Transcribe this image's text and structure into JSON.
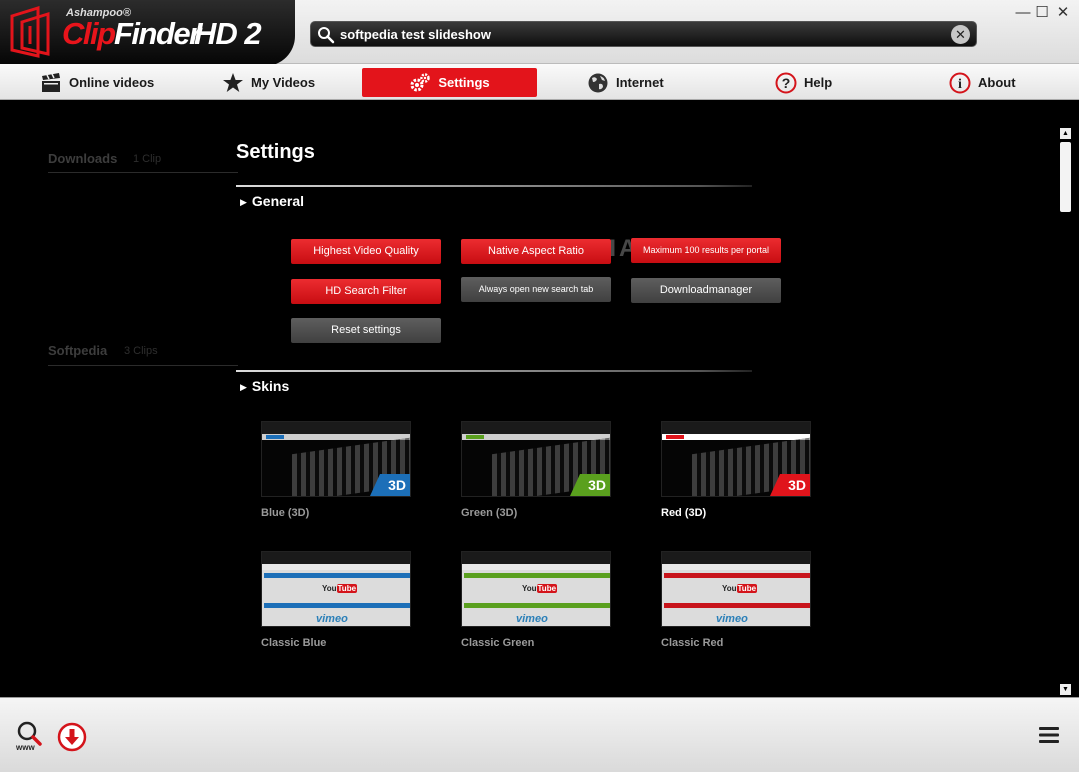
{
  "app": {
    "brand": "Ashampoo®",
    "name_clip": "Clip",
    "name_finder": "Finder",
    "name_hd": "HD 2"
  },
  "search": {
    "value": "softpedia test slideshow"
  },
  "window": {
    "minimize": "—",
    "maximize": "☐",
    "close": "✕"
  },
  "nav": [
    {
      "label": "Online videos",
      "icon": "clapperboard-icon"
    },
    {
      "label": "My Videos",
      "icon": "star-icon"
    },
    {
      "label": "Settings",
      "icon": "gears-icon",
      "active": true
    },
    {
      "label": "Internet",
      "icon": "globe-icon"
    },
    {
      "label": "Help",
      "icon": "question-icon"
    },
    {
      "label": "About",
      "icon": "info-icon"
    }
  ],
  "sidebar": [
    {
      "title": "Downloads",
      "count": "1 Clip"
    },
    {
      "title": "Softpedia",
      "count": "3 Clips"
    }
  ],
  "settings": {
    "title": "Settings",
    "general_label": "General",
    "skins_label": "Skins",
    "buttons": {
      "highest_quality": "Highest Video Quality",
      "native_aspect": "Native Aspect Ratio",
      "max_results": "Maximum 100 results per portal",
      "hd_filter": "HD Search Filter",
      "new_tab": "Always open new search tab",
      "download_manager": "Downloadmanager",
      "reset": "Reset settings"
    },
    "watermark": "SOFTPEDIA",
    "skins": [
      {
        "name": "Blue (3D)",
        "badge": "3D",
        "accent": "#1c6fb8",
        "selected": false
      },
      {
        "name": "Green (3D)",
        "badge": "3D",
        "accent": "#5aa01e",
        "selected": false
      },
      {
        "name": "Red (3D)",
        "badge": "3D",
        "accent": "#e0141b",
        "selected": true
      },
      {
        "name": "Classic Blue",
        "accent": "#1c6fb8",
        "selected": false
      },
      {
        "name": "Classic Green",
        "accent": "#5aa01e",
        "selected": false
      },
      {
        "name": "Classic Red",
        "accent": "#c8141b",
        "selected": false
      }
    ],
    "classic_thumb": {
      "youtube_you": "You",
      "youtube_tube": "Tube",
      "vimeo": "vimeo"
    }
  },
  "colors": {
    "accent": "#e3141b",
    "button_gray": "#4d4d4d",
    "background": "#000000"
  }
}
